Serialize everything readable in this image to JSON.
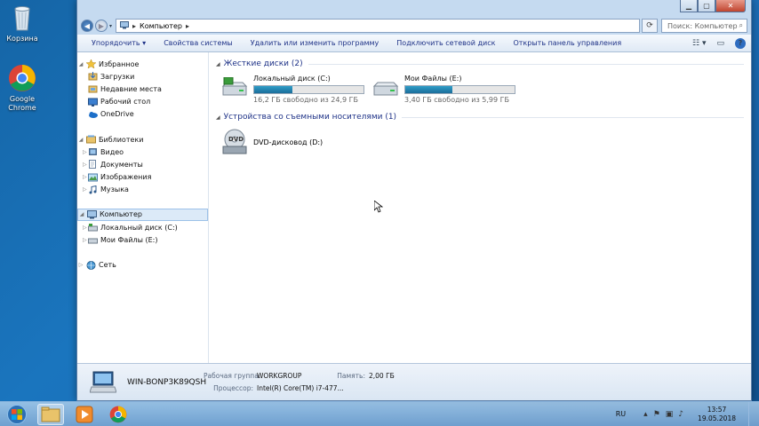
{
  "desktop": {
    "icons": [
      {
        "label": "Корзина",
        "icon": "recycle-bin-icon"
      },
      {
        "label": "Google Chrome",
        "icon": "chrome-icon"
      }
    ]
  },
  "window": {
    "address": {
      "root_icon": "computer-icon",
      "path": "Компьютер"
    },
    "search_placeholder": "Поиск: Компьютер",
    "toolbar": {
      "organize": "Упорядочить ▾",
      "system_props": "Свойства системы",
      "uninstall": "Удалить или изменить программу",
      "map_drive": "Подключить сетевой диск",
      "control_panel": "Открыть панель управления"
    },
    "nav": {
      "favorites": "Избранное",
      "downloads": "Загрузки",
      "recent": "Недавние места",
      "desktop": "Рабочий стол",
      "onedrive": "OneDrive",
      "libraries": "Библиотеки",
      "video": "Видео",
      "documents": "Документы",
      "pictures": "Изображения",
      "music": "Музыка",
      "computer": "Компьютер",
      "local_c": "Локальный диск (C:)",
      "my_files": "Мои Файлы (E:)",
      "network": "Сеть"
    },
    "groups": {
      "hdd": "Жесткие диски (2)",
      "removable": "Устройства со съемными носителями (1)"
    },
    "drives": [
      {
        "name": "Локальный диск (C:)",
        "free": "16,2 ГБ свободно из 24,9 ГБ",
        "used_fraction": 0.35
      },
      {
        "name": "Мои Файлы (E:)",
        "free": "3,40 ГБ свободно из 5,99 ГБ",
        "used_fraction": 0.43
      }
    ],
    "dvd": {
      "name": "DVD-дисковод (D:)",
      "badge": "DVD"
    },
    "details": {
      "pc_name": "WIN-BONP3K89QSH",
      "workgroup_label": "Рабочая группа:",
      "workgroup": "WORKGROUP",
      "memory_label": "Память:",
      "memory": "2,00 ГБ",
      "cpu_label": "Процессор:",
      "cpu": "Intel(R) Core(TM) i7-477..."
    }
  },
  "taskbar": {
    "lang": "RU",
    "time": "13:57",
    "date": "19.05.2018"
  },
  "colors": {
    "accent": "#1e3287",
    "progress": "#1b6d9a"
  }
}
